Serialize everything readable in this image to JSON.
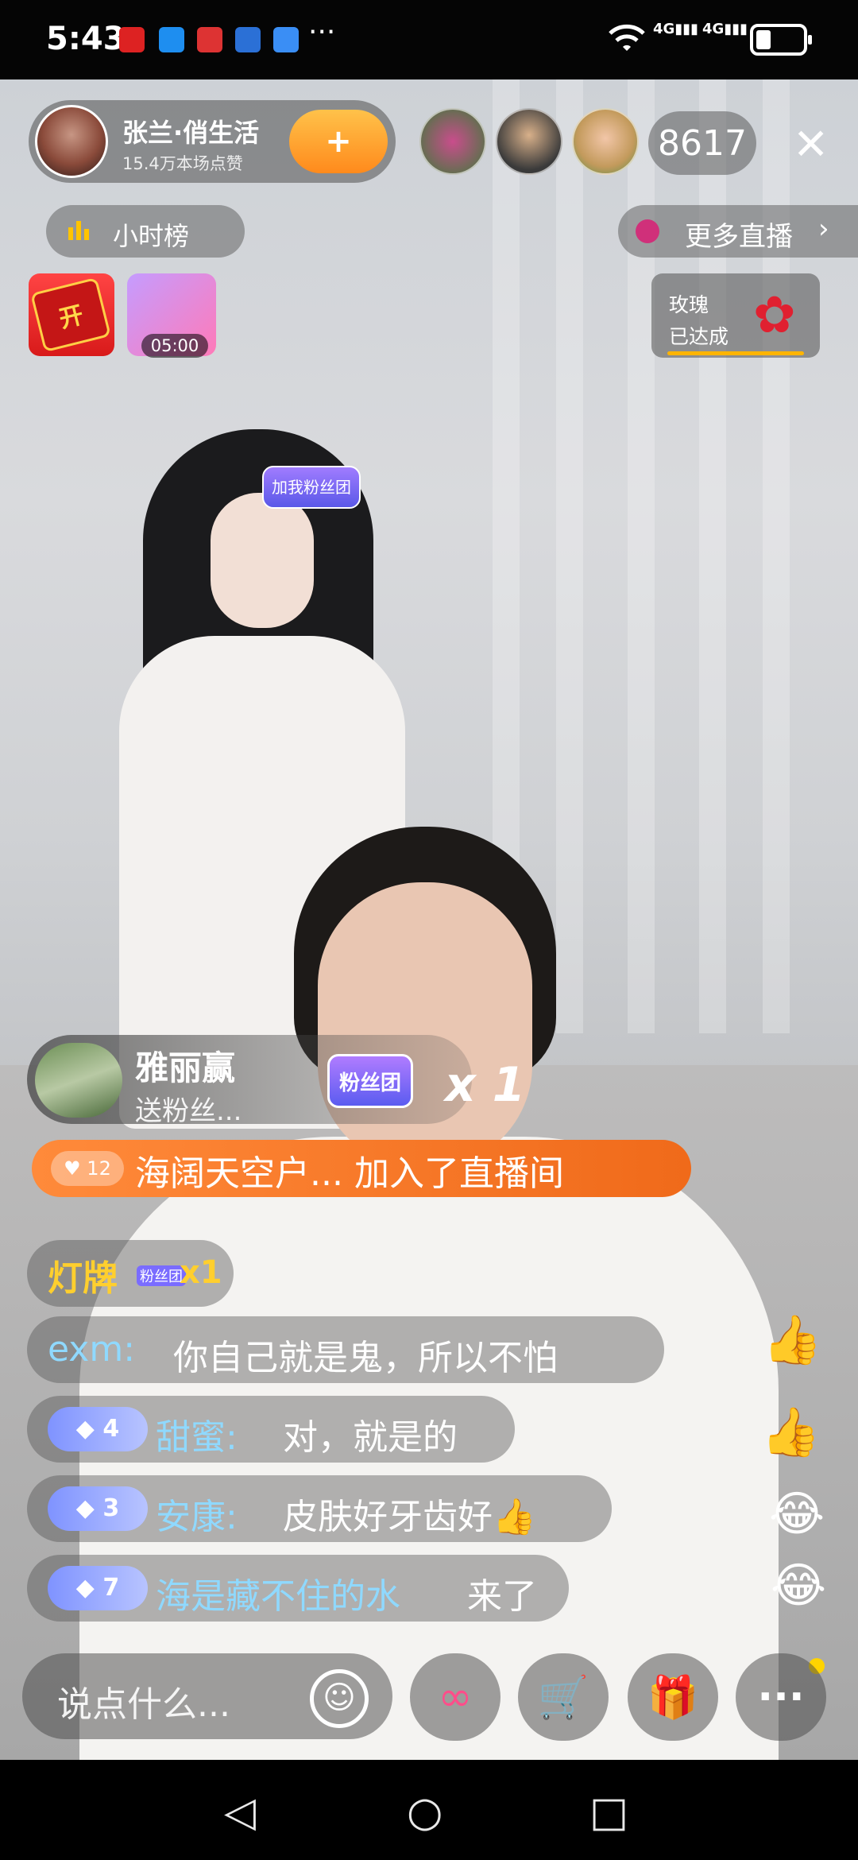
{
  "status_bar": {
    "time": "5:43",
    "more": "···",
    "network_1": "4G",
    "network_2": "4G"
  },
  "anchor": {
    "name": "张兰·俏生活",
    "likes": "15.4万本场点赞",
    "follow_label": "+"
  },
  "viewers": {
    "count": "8617"
  },
  "close_label": "✕",
  "rank": {
    "label": "小时榜"
  },
  "more_live": {
    "label": "更多直播",
    "chevron": "›"
  },
  "red_packet": {
    "label": "开"
  },
  "gift_timer": "05:00",
  "rose_task": {
    "title": "玫瑰",
    "status": "已达成"
  },
  "fans_badge_head": "加我粉丝团",
  "gift_banner": {
    "user": "雅丽赢",
    "text": "送粉丝...",
    "badge": "粉丝团",
    "count": "x 1"
  },
  "join_banner": {
    "level": "12",
    "text": "海阔天空户... 加入了直播间"
  },
  "chat": [
    {
      "name": "灯牌",
      "text": "x1",
      "level": ""
    },
    {
      "name": "exm:",
      "text": "你自己就是鬼，所以不怕",
      "level": ""
    },
    {
      "name": "甜蜜:",
      "text": "对，就是的",
      "level": "4"
    },
    {
      "name": "安康:",
      "text": "皮肤好牙齿好👍",
      "level": "3"
    },
    {
      "name": "海是藏不住的水",
      "text": "来了",
      "level": "7"
    }
  ],
  "chat_mini_badge": "粉丝团",
  "bottom_bar": {
    "input_placeholder": "说点什么...",
    "emoji": "☺",
    "link": "∞",
    "cart": "🛒",
    "gift": "🎁",
    "more": "···"
  },
  "nav": {
    "back": "◁",
    "home": "○",
    "recent": "□"
  },
  "accent_colors": {
    "orange": "#f06a1a",
    "gold": "#ffcf2e",
    "blue": "#8fd9ff"
  }
}
